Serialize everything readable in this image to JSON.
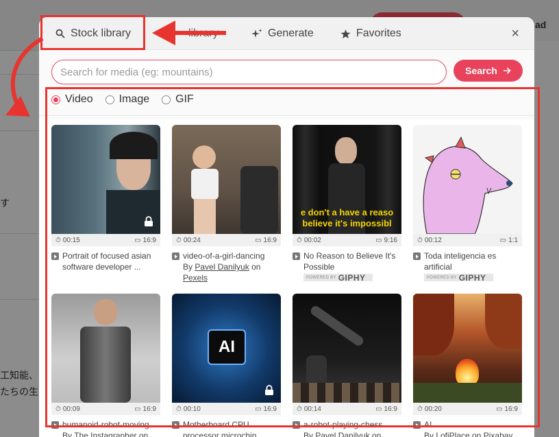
{
  "background": {
    "corner_text": "ad",
    "side_char": "す",
    "jp_line1": "工知能、",
    "jp_line2": "たちの生"
  },
  "modal": {
    "tabs": [
      {
        "label": "Stock library",
        "icon": "search-icon"
      },
      {
        "label": "library",
        "icon": ""
      },
      {
        "label": "Generate",
        "icon": "sparkle-icon"
      },
      {
        "label": "Favorites",
        "icon": "star-icon"
      }
    ],
    "close_label": "×",
    "search": {
      "placeholder": "Search for media (eg: mountains)",
      "value": "",
      "button_label": "Search",
      "button_icon": "arrow-right-icon"
    },
    "media_types": [
      {
        "label": "Video",
        "checked": true
      },
      {
        "label": "Image",
        "checked": false
      },
      {
        "label": "GIF",
        "checked": false
      }
    ],
    "accent_color": "#e8425d"
  },
  "cards": [
    {
      "duration": "00:15",
      "ratio": "16:9",
      "title": "Portrait of focused asian software developer ...",
      "locked": true
    },
    {
      "duration": "00:24",
      "ratio": "16:9",
      "title": "video-of-a-girl-dancing",
      "by_prefix": "By",
      "author": "Pavel Danilyuk",
      "on": "on",
      "source": "Pexels",
      "locked": false
    },
    {
      "duration": "00:02",
      "ratio": "9:16",
      "title": "No Reason to Believe It's Possible",
      "giphy": "GIPHY",
      "powered_by": "POWERED BY",
      "overlay_line1": "e don't a have a reaso",
      "overlay_line2": "believe it's impossibl",
      "locked": false
    },
    {
      "duration": "00:12",
      "ratio": "1:1",
      "title": "Toda inteligencia es artificial",
      "giphy": "GIPHY",
      "powered_by": "POWERED BY",
      "locked": false
    },
    {
      "duration": "00:09",
      "ratio": "16:9",
      "title": "humanoid-robot-moving",
      "byline": "By The Instagrapher on",
      "locked": false
    },
    {
      "duration": "00:10",
      "ratio": "16:9",
      "title": "Motherboard CPU processor microchip",
      "chip_text": "AI",
      "locked": true
    },
    {
      "duration": "00:14",
      "ratio": "16:9",
      "title": "a-robot-playing-chess",
      "byline": "By Pavel Danilyuk on",
      "locked": false
    },
    {
      "duration": "00:20",
      "ratio": "16:9",
      "title": "AI",
      "byline": "By LofiPlace on Pixabay",
      "locked": false
    }
  ],
  "annotation_color": "#e8342f"
}
